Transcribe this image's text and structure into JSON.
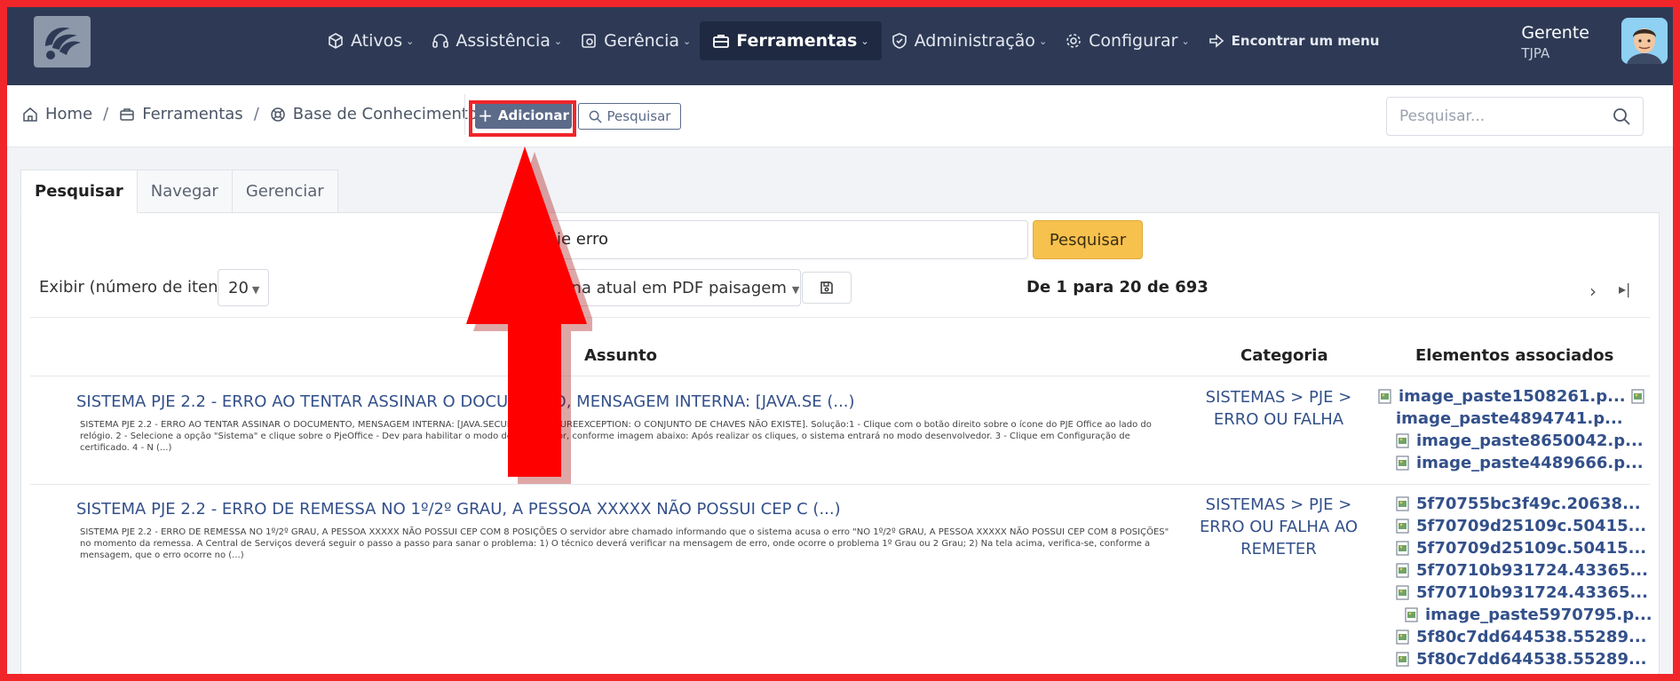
{
  "nav": {
    "items": [
      {
        "label": "Ativos",
        "icon": "cube-icon"
      },
      {
        "label": "Assistência",
        "icon": "headset-icon"
      },
      {
        "label": "Gerência",
        "icon": "dashboard-icon"
      },
      {
        "label": "Ferramentas",
        "icon": "briefcase-icon",
        "active": true
      },
      {
        "label": "Administração",
        "icon": "shield-icon"
      },
      {
        "label": "Configurar",
        "icon": "cog-icon"
      }
    ],
    "find_menu": "Encontrar um menu"
  },
  "user": {
    "name": "Gerente",
    "org": "TJPA"
  },
  "breadcrumb": {
    "home": "Home",
    "tools": "Ferramentas",
    "kb": "Base de Conhecimento"
  },
  "toolbar": {
    "add_label": "Adicionar",
    "search_label": "Pesquisar"
  },
  "top_search": {
    "placeholder": "Pesquisar..."
  },
  "tabs": [
    "Pesquisar",
    "Navegar",
    "Gerenciar"
  ],
  "search": {
    "query_visible": "je erro",
    "button": "Pesquisar"
  },
  "display": {
    "label": "Exibir (número de itens)",
    "value": "20"
  },
  "export": {
    "selected_visible": "gina atual em PDF paisagem"
  },
  "pager": {
    "text": "De 1 para 20 de 693"
  },
  "table": {
    "headers": {
      "subject": "Assunto",
      "category": "Categoria",
      "attachments": "Elementos associados"
    },
    "rows": [
      {
        "subject": "SISTEMA PJE 2.2 - ERRO AO TENTAR ASSINAR O DOCUMENTO, MENSAGEM INTERNA: [JAVA.SE (...)",
        "snippet": "SISTEMA PJE 2.2 - ERRO AO TENTAR ASSINAR O DOCUMENTO, MENSAGEM INTERNA: [JAVA.SECURITY.SIGNATUREEXCEPTION: O CONJUNTO DE CHAVES NÃO EXISTE].     Solução:1 - Clique com o botão direito sobre o ícone do PJE Office ao lado do relógio.   2 - Selecione a opção \"Sistema\" e clique sobre o PjeOffice - Dev para habilitar o modo desenvolvedor, conforme imagem abaixo: Após realizar os cliques, o sistema entrará no modo desenvolvedor.   3 - Clique em Configuração de certificado. 4 -   N (...)",
        "category": [
          "SISTEMAS > PJE >",
          "ERRO OU FALHA"
        ],
        "attachments": [
          "image_paste1508261.p...",
          "image_paste4894741.p...",
          "image_paste8650042.p...",
          "image_paste4489666.p..."
        ]
      },
      {
        "subject": "SISTEMA PJE 2.2 - ERRO DE REMESSA NO 1º/2º GRAU, A PESSOA XXXXX NÃO POSSUI CEP C (...)",
        "snippet": "SISTEMA PJE 2.2 - ERRO DE REMESSA NO 1º/2º GRAU, A PESSOA XXXXX NÃO POSSUI CEP COM 8 POSIÇÕES O servidor abre chamado informando que o sistema acusa o erro \"NO 1º/2º GRAU, A PESSOA XXXXX NÃO POSSUI CEP COM 8 POSIÇÕES\" no momento da remessa.     A Central de Serviços deverá seguir o passo a passo para sanar o problema: 1) O técnico deverá verificar na mensagem de erro, onde ocorre o problema 1º Grau ou 2 Grau; 2) Na tela acima, verifica-se, conforme a mensagem, que o erro ocorre no (...)",
        "category": [
          "SISTEMAS > PJE >",
          "ERRO OU FALHA AO",
          "REMETER"
        ],
        "attachments": [
          "5f70755bc3f49c.20638...",
          "5f70709d25109c.50415...",
          "5f70709d25109c.50415...",
          "5f70710b931724.43365...",
          "5f70710b931724.43365...",
          "image_paste5970795.p...",
          "5f80c7dd644538.55289...",
          "5f80c7dd644538.55289..."
        ]
      }
    ]
  },
  "colors": {
    "navbar": "#2e3a55",
    "accent_button": "#5c6b8a",
    "search_button": "#f7c14e",
    "highlight": "#f0262b",
    "link": "#33508a"
  }
}
